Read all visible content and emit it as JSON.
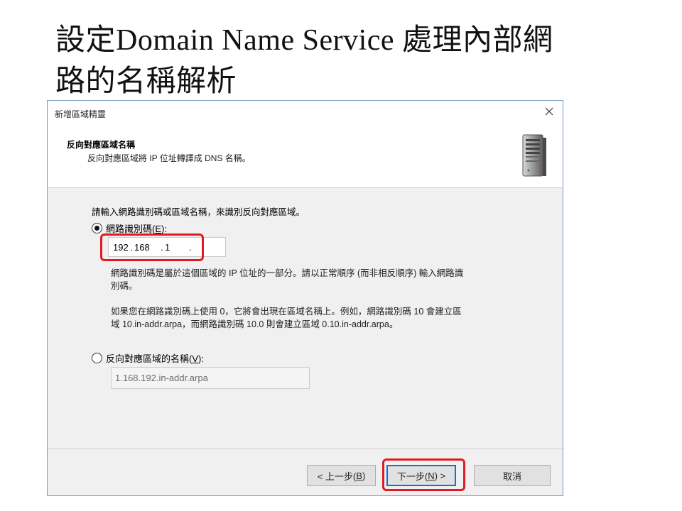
{
  "slide": {
    "title_line1": "設定Domain Name Service 處理內部網",
    "title_line2": "路的名稱解析"
  },
  "dialog": {
    "window_title": "新增區域精靈",
    "header_title": "反向對應區域名稱",
    "header_desc": "反向對應區域將 IP 位址轉譯成 DNS 名稱。",
    "instruction": "請輸入網路識別碼或區域名稱，來識別反向對應區域。",
    "network_id_option": {
      "label_prefix": "網路識別碼(",
      "accel": "E",
      "label_suffix": "):",
      "selected": true
    },
    "network_id_value": {
      "seg1": "192",
      "seg2": "168",
      "seg3": "1",
      "seg4": ""
    },
    "help_para1_line1": "網路識別碼是屬於這個區域的 IP 位址的一部分。請以正常順序 (而非相反順序) 輸入網路識",
    "help_para1_line2": "別碼。",
    "help_para2_line1": "如果您在網路識別碼上使用 0，它將會出現在區域名稱上。例如，網路識別碼 10 會建立區",
    "help_para2_line2": "域 10.in-addr.arpa，而網路識別碼 10.0 則會建立區域 0.10.in-addr.arpa。",
    "zone_name_option": {
      "label_prefix": "反向對應區域的名稱(",
      "accel": "V",
      "label_suffix": "):",
      "selected": false
    },
    "zone_name_value": "1.168.192.in-addr.arpa",
    "buttons": {
      "back_prefix": "< 上一步(",
      "back_accel": "B",
      "back_suffix": ")",
      "next_prefix": "下一步(",
      "next_accel": "N",
      "next_suffix": ") >",
      "cancel": "取消"
    }
  },
  "colors": {
    "highlight": "#e01a22",
    "dialog_border": "#7a9cc4",
    "default_button_border": "#0078d7"
  },
  "icons": [
    "close-icon",
    "server-icon"
  ]
}
